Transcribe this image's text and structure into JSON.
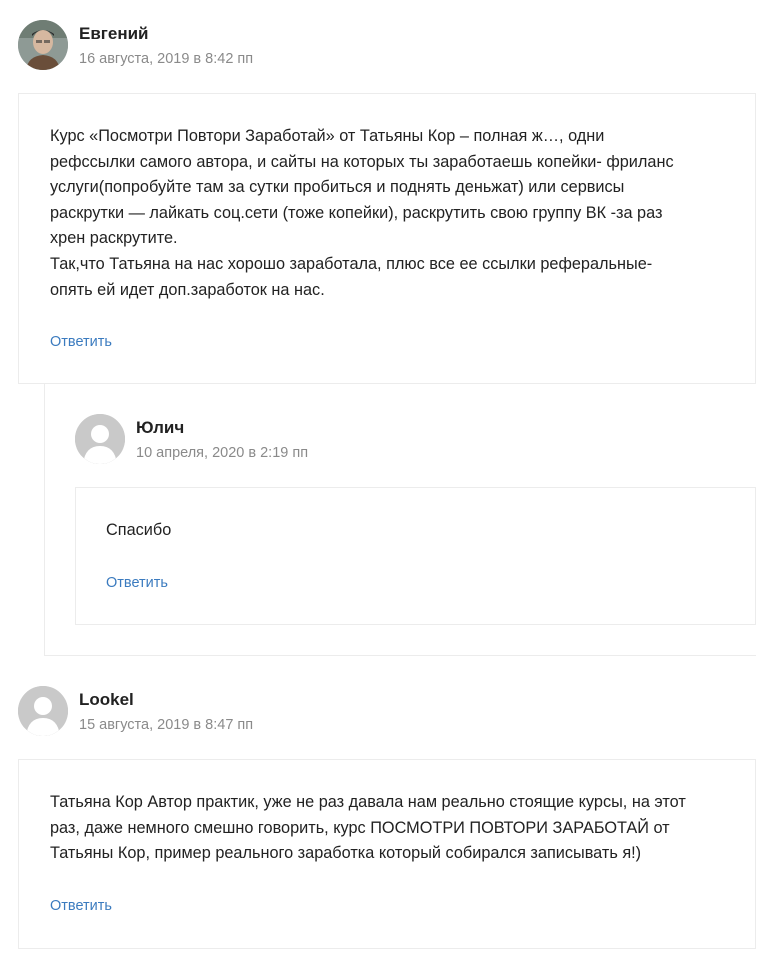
{
  "comments": [
    {
      "author": "Евгений",
      "date": "16 августа, 2019 в 8:42 пп",
      "lines": [
        "Курс «Посмотри Повтори Заработай» от Татьяны Кор – полная ж…, одни",
        "рефссылки самого автора, и сайты на которых ты заработаешь копейки- фриланс",
        "услуги(попробуйте там за сутки пробиться и поднять деньжат) или сервисы",
        "раскрутки — лайкать соц.сети (тоже копейки), раскрутить свою группу ВК -за раз",
        "хрен раскрутите.",
        "Так,что Татьяна на нас хорошо заработала, плюс все ее ссылки реферальные-",
        "опять ей идет доп.заработок на нас."
      ],
      "reply_label": "Ответить",
      "avatar_icon": "user-photo-avatar",
      "replies": [
        {
          "author": "Юлич",
          "date": "10 апреля, 2020 в 2:19 пп",
          "lines": [
            "Спасибо"
          ],
          "reply_label": "Ответить",
          "avatar_icon": "default-user-avatar"
        }
      ]
    },
    {
      "author": "Lookel",
      "date": "15 августа, 2019 в 8:47 пп",
      "lines": [
        "Татьяна Кор Автор практик, уже не раз давала нам реально стоящие курсы, на этот",
        "раз, даже немного смешно говорить, курс ПОСМОТРИ ПОВТОРИ ЗАРАБОТАЙ от",
        "Татьяны Кор, пример реального заработка который собирался записывать я!)"
      ],
      "reply_label": "Ответить",
      "avatar_icon": "default-user-avatar"
    }
  ],
  "colors": {
    "link": "#3b7bbf",
    "date": "#8a8a8a",
    "border": "#ececec",
    "text": "#222222"
  }
}
